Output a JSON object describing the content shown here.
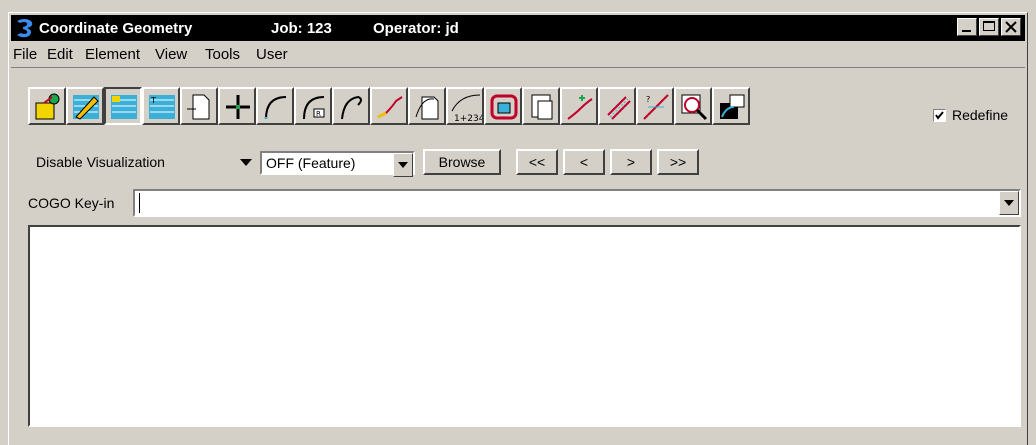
{
  "window": {
    "title": "Coordinate Geometry",
    "job_label": "Job: 123",
    "operator_label": "Operator: jd"
  },
  "menu": [
    {
      "label": "File"
    },
    {
      "label": "Edit"
    },
    {
      "label": "Element"
    },
    {
      "label": "View"
    },
    {
      "label": "Tools"
    },
    {
      "label": "User"
    }
  ],
  "toolbar": {
    "redefine_label": "Redefine",
    "redefine_checked": true
  },
  "visualization": {
    "selected": "Disable Visualization"
  },
  "feature_filter": {
    "selected": "OFF (Feature)"
  },
  "navigation": {
    "browse_label": "Browse",
    "first_label": "<<",
    "prev_label": "<",
    "next_label": ">",
    "last_label": ">>"
  },
  "keyin": {
    "label": "COGO Key-in",
    "value": ""
  },
  "colors": {
    "face": "#d4d0c8",
    "titlebar": "#000000"
  }
}
